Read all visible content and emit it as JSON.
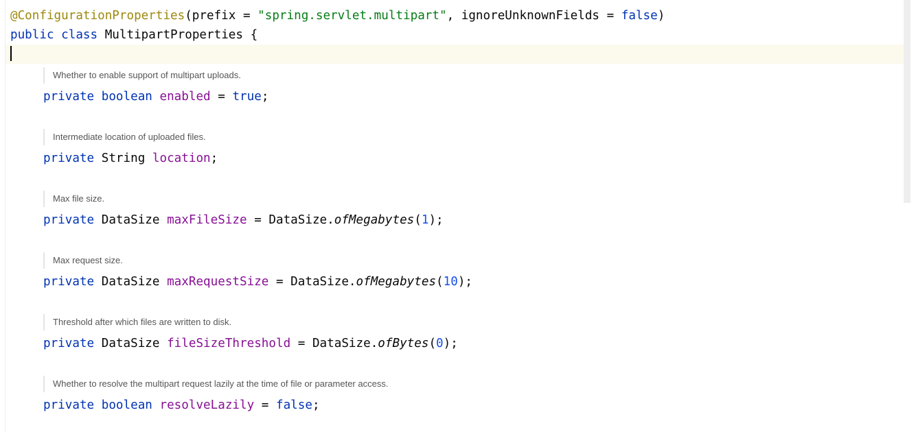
{
  "annotation_line": {
    "annotation": "@ConfigurationProperties",
    "open": "(prefix = ",
    "prefix_value": "\"spring.servlet.multipart\"",
    "mid": ", ignoreUnknownFields = ",
    "ignore_value": "false",
    "close": ")"
  },
  "class_line": {
    "kw_public": "public",
    "kw_class": "class",
    "name": "MultipartProperties",
    "brace": "{"
  },
  "fields": [
    {
      "doc": "Whether to enable support of multipart uploads.",
      "modifier": "private",
      "type": "boolean",
      "name": "enabled",
      "assign": " = ",
      "value": "true",
      "end": ";"
    },
    {
      "doc": "Intermediate location of uploaded files.",
      "modifier": "private",
      "type": "String",
      "name": "location",
      "end": ";"
    },
    {
      "doc": "Max file size.",
      "modifier": "private",
      "type": "DataSize",
      "name": "maxFileSize",
      "assign": " = ",
      "cls": "DataSize.",
      "method": "ofMegabytes",
      "arg": "1",
      "end": ");"
    },
    {
      "doc": "Max request size.",
      "modifier": "private",
      "type": "DataSize",
      "name": "maxRequestSize",
      "assign": " = ",
      "cls": "DataSize.",
      "method": "ofMegabytes",
      "arg": "10",
      "end": ");"
    },
    {
      "doc": "Threshold after which files are written to disk.",
      "modifier": "private",
      "type": "DataSize",
      "name": "fileSizeThreshold",
      "assign": " = ",
      "cls": "DataSize.",
      "method": "ofBytes",
      "arg": "0",
      "end": ");"
    },
    {
      "doc": "Whether to resolve the multipart request lazily at the time of file or parameter access.",
      "modifier": "private",
      "type": "boolean",
      "name": "resolveLazily",
      "assign": " = ",
      "value": "false",
      "end": ";"
    }
  ]
}
